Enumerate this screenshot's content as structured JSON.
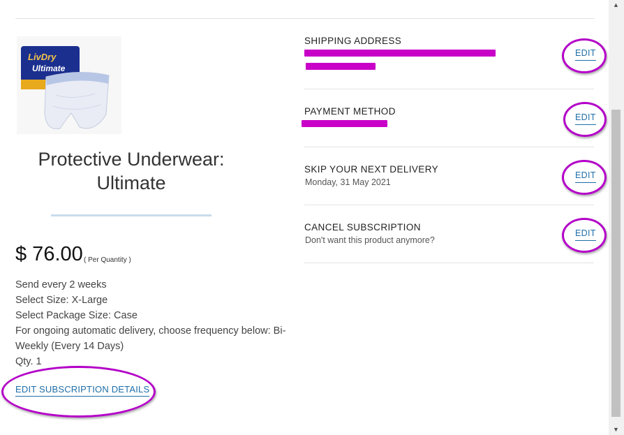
{
  "product": {
    "title_line1": "Protective Underwear:",
    "title_line2": "Ultimate",
    "image_brand": "LivDry",
    "image_subtitle": "Ultimate",
    "price": "$ 76.00",
    "price_unit": "( Per Quantity )",
    "details": [
      "Send every 2 weeks",
      "Select Size: X-Large",
      "Select Package Size: Case",
      "For ongoing automatic delivery, choose frequency below: Bi-",
      "Weekly (Every 14 Days)",
      "Qty. 1"
    ],
    "edit_subscription_label": "EDIT SUBSCRIPTION DETAILS"
  },
  "rows": {
    "shipping": {
      "label": "SHIPPING ADDRESS",
      "edit": "EDIT"
    },
    "payment": {
      "label": "PAYMENT METHOD",
      "edit": "EDIT"
    },
    "skip": {
      "label": "SKIP YOUR NEXT DELIVERY",
      "sub": "Monday, 31 May 2021",
      "edit": "EDIT"
    },
    "cancel": {
      "label": "CANCEL SUBSCRIPTION",
      "sub": "Don't want this product anymore?",
      "edit": "EDIT"
    }
  },
  "colors": {
    "link": "#1e6ea8",
    "annotation": "#b400c8",
    "redaction": "#c800c8",
    "divider": "#c9dcec"
  },
  "icons": [
    "scroll-up-arrow-icon",
    "scroll-down-arrow-icon"
  ]
}
